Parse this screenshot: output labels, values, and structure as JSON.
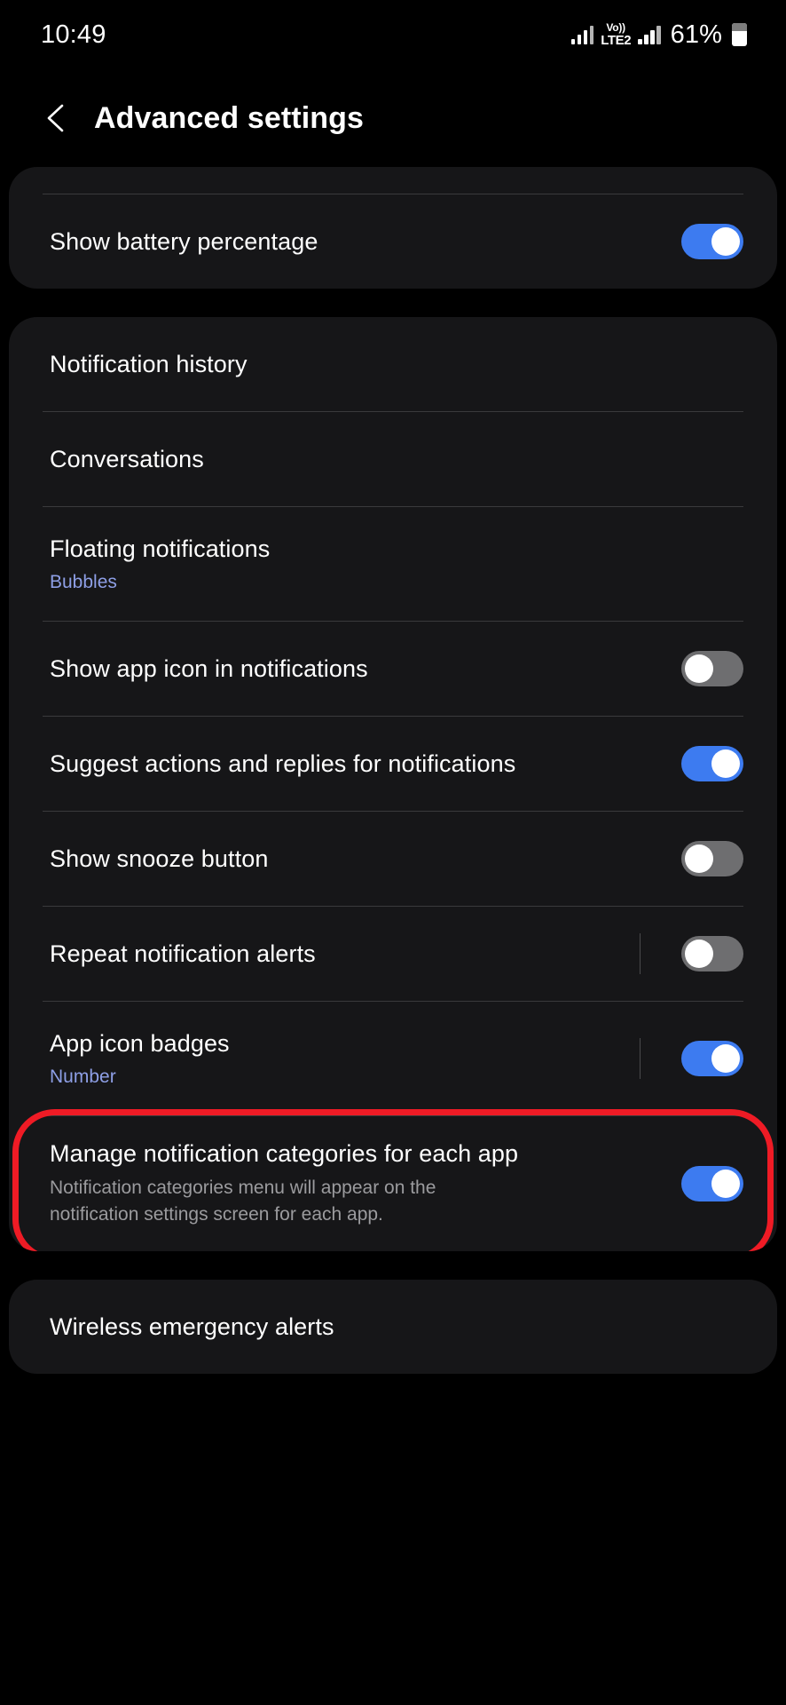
{
  "status_bar": {
    "time": "10:49",
    "network_tech_top": "Vo))",
    "network_tech_bottom": "LTE2",
    "battery_percent": "61%",
    "icons": [
      "signal-bars-icon",
      "volte-icon",
      "signal-bars-icon",
      "battery-icon"
    ]
  },
  "header": {
    "back_icon": "back-chevron-icon",
    "title": "Advanced settings"
  },
  "colors": {
    "background": "#000000",
    "card": "#161618",
    "toggle_on": "#3d7bf0",
    "toggle_off": "#6e6e70",
    "link_blue": "#8e9fe6",
    "highlight_red": "#ef1b25",
    "divider": "#3a3a3c",
    "subtitle_grey": "#9b9b9e"
  },
  "cards": [
    {
      "name": "battery-card",
      "rows": [
        {
          "name": "show-battery-percentage",
          "title": "Show battery percentage",
          "subtitle": "",
          "subtitle_style": "none",
          "control": "toggle",
          "toggle_state": "on",
          "vbar": false,
          "top_divider": true,
          "highlight": false
        }
      ]
    },
    {
      "name": "notifications-card",
      "rows": [
        {
          "name": "notification-history",
          "title": "Notification history",
          "subtitle": "",
          "subtitle_style": "none",
          "control": "none",
          "toggle_state": "",
          "vbar": false,
          "top_divider": false,
          "highlight": false
        },
        {
          "name": "conversations",
          "title": "Conversations",
          "subtitle": "",
          "subtitle_style": "none",
          "control": "none",
          "toggle_state": "",
          "vbar": false,
          "top_divider": false,
          "highlight": false
        },
        {
          "name": "floating-notifications",
          "title": "Floating notifications",
          "subtitle": "Bubbles",
          "subtitle_style": "blue",
          "control": "none",
          "toggle_state": "",
          "vbar": false,
          "top_divider": false,
          "highlight": false
        },
        {
          "name": "show-app-icon-in-notifications",
          "title": "Show app icon in notifications",
          "subtitle": "",
          "subtitle_style": "none",
          "control": "toggle",
          "toggle_state": "off",
          "vbar": false,
          "top_divider": false,
          "highlight": false
        },
        {
          "name": "suggest-actions-and-replies",
          "title": "Suggest actions and replies for notifications",
          "subtitle": "",
          "subtitle_style": "none",
          "control": "toggle",
          "toggle_state": "on",
          "vbar": false,
          "top_divider": false,
          "highlight": false
        },
        {
          "name": "show-snooze-button",
          "title": "Show snooze button",
          "subtitle": "",
          "subtitle_style": "none",
          "control": "toggle",
          "toggle_state": "off",
          "vbar": false,
          "top_divider": false,
          "highlight": false
        },
        {
          "name": "repeat-notification-alerts",
          "title": "Repeat notification alerts",
          "subtitle": "",
          "subtitle_style": "none",
          "control": "toggle",
          "toggle_state": "off",
          "vbar": true,
          "top_divider": false,
          "highlight": false
        },
        {
          "name": "app-icon-badges",
          "title": "App icon badges",
          "subtitle": "Number",
          "subtitle_style": "blue",
          "control": "toggle",
          "toggle_state": "on",
          "vbar": true,
          "top_divider": false,
          "highlight": false
        },
        {
          "name": "manage-notification-categories",
          "title": "Manage notification categories for each app",
          "subtitle": "Notification categories menu will appear on the notification settings screen for each app.",
          "subtitle_style": "grey",
          "control": "toggle",
          "toggle_state": "on",
          "vbar": false,
          "top_divider": false,
          "highlight": true
        }
      ]
    },
    {
      "name": "emergency-alerts-card",
      "rows": [
        {
          "name": "wireless-emergency-alerts",
          "title": "Wireless emergency alerts",
          "subtitle": "",
          "subtitle_style": "none",
          "control": "none",
          "toggle_state": "",
          "vbar": false,
          "top_divider": false,
          "highlight": false
        }
      ]
    }
  ]
}
